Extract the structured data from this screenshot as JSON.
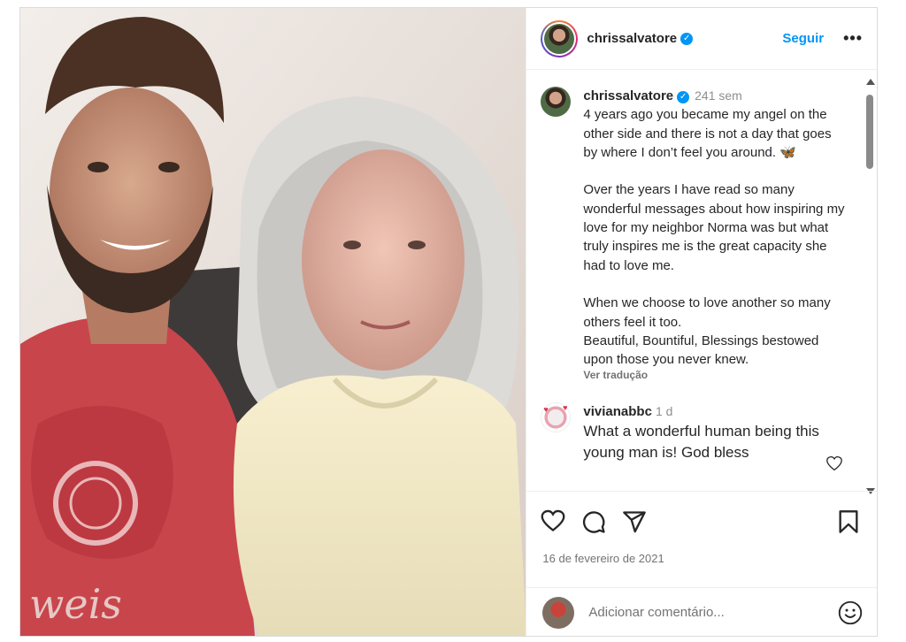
{
  "post": {
    "username": "chrissalvatore",
    "follow_label": "Seguir",
    "more_label": "•••",
    "verified_mark": "✓"
  },
  "caption": {
    "username": "chrissalvatore",
    "time": "241 sem",
    "text": "4 years ago you became my angel on the other side and there is not a day that goes by where I don’t feel you around. 🦋\n\nOver the years I have read so many wonderful messages about how inspiring my love for my neighbor Norma was but what truly inspires me is the great capacity she had to love me.\n\nWhen we choose to love another so many others feel it too.\nBeautiful, Bountiful, Blessings bestowed upon those you never knew.",
    "translate_label": "Ver tradução"
  },
  "comments": [
    {
      "username": "vivianabbc",
      "time": "1 d",
      "text": "What a wonderful human being this young man is! God bless"
    }
  ],
  "actions": {
    "like_icon": "heart-icon",
    "comment_icon": "comment-icon",
    "share_icon": "share-icon",
    "save_icon": "bookmark-icon",
    "date": "16 de fevereiro de 2021"
  },
  "add_comment": {
    "placeholder": "Adicionar comentário...",
    "emoji_icon": "smiley-icon"
  },
  "colors": {
    "accent": "#0095f6",
    "text": "#262626",
    "muted": "#737373"
  }
}
